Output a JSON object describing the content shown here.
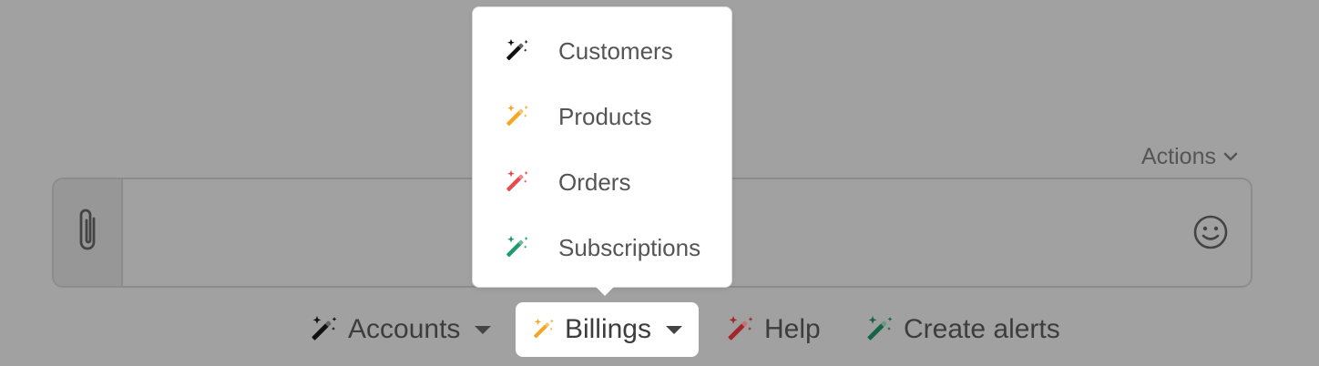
{
  "colors": {
    "background": "#a1a1a1",
    "wand_black": "#111111",
    "wand_orange": "#f5a623",
    "wand_red": "#e84b4b",
    "wand_green": "#1f9a6a",
    "wand_red_dim": "#a3262a",
    "wand_green_dim": "#156447"
  },
  "header": {
    "actions_label": "Actions",
    "actions_icon": "chevron-down-icon"
  },
  "composer": {
    "attach_icon": "paperclip-icon",
    "placeholder": "",
    "emoji_icon": "smiley-icon"
  },
  "toolbar": {
    "items": [
      {
        "label": "Accounts",
        "icon": "magic-wand-icon",
        "has_dropdown": true,
        "active": false
      },
      {
        "label": "Billings",
        "icon": "magic-wand-icon",
        "has_dropdown": true,
        "active": true
      },
      {
        "label": "Help",
        "icon": "magic-wand-icon",
        "has_dropdown": false,
        "active": false
      },
      {
        "label": "Create alerts",
        "icon": "magic-wand-icon",
        "has_dropdown": false,
        "active": false
      }
    ]
  },
  "dropdown": {
    "items": [
      {
        "label": "Customers",
        "icon": "magic-wand-icon"
      },
      {
        "label": "Products",
        "icon": "magic-wand-icon"
      },
      {
        "label": "Orders",
        "icon": "magic-wand-icon"
      },
      {
        "label": "Subscriptions",
        "icon": "magic-wand-icon"
      }
    ]
  }
}
